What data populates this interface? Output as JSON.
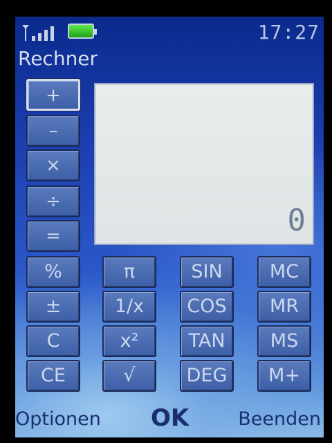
{
  "status": {
    "time": "17:27",
    "signal_icon": "signal-strength-icon",
    "battery_icon": "battery-icon"
  },
  "app": {
    "title": "Rechner"
  },
  "display": {
    "value": "0"
  },
  "operators": [
    "+",
    "–",
    "×",
    "÷",
    "="
  ],
  "keys": {
    "row1": [
      "%",
      "π",
      "SIN",
      "MC"
    ],
    "row2": [
      "±",
      "1/x",
      "COS",
      "MR"
    ],
    "row3": [
      "C",
      "x²",
      "TAN",
      "MS"
    ],
    "row4": [
      "CE",
      "√",
      "DEG",
      "M+"
    ]
  },
  "softkeys": {
    "left": "Optionen",
    "center": "OK",
    "right": "Beenden"
  }
}
